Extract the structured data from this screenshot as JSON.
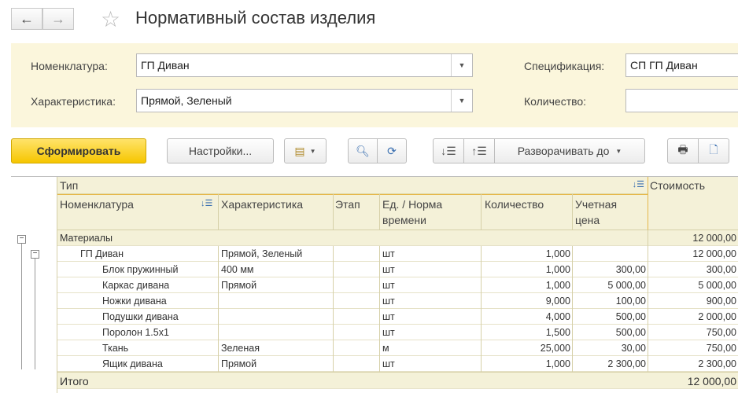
{
  "window": {
    "title": "Нормативный состав изделия"
  },
  "icons": {
    "back": "arrow-left-icon",
    "forward": "arrow-right-icon",
    "favorite": "star-icon"
  },
  "form": {
    "nomenclature_label": "Номенклатура:",
    "nomenclature_value": "ГП Диван",
    "characteristic_label": "Характеристика:",
    "characteristic_value": "Прямой, Зеленый",
    "specification_label": "Спецификация:",
    "specification_value": "СП ГП Диван",
    "quantity_label": "Количество:",
    "quantity_value": ""
  },
  "toolbar": {
    "generate_label": "Сформировать",
    "settings_label": "Настройки...",
    "expand_label": "Разворачивать до"
  },
  "table": {
    "headers": {
      "type": "Тип",
      "nomenclature": "Номенклатура",
      "characteristic": "Характеристика",
      "stage": "Этап",
      "unit_norm_1": "Ед. / Норма",
      "unit_norm_2": "времени",
      "quantity": "Количество",
      "price_1": "Учетная",
      "price_2": "цена",
      "cost": "Стоимость"
    },
    "group": {
      "type": "Материалы",
      "cost": "12 000,00"
    },
    "product": {
      "name": "ГП Диван",
      "characteristic": "Прямой, Зеленый",
      "unit": "шт",
      "quantity": "1,000",
      "price": "",
      "cost": "12 000,00"
    },
    "rows": [
      {
        "name": "Блок пружинный",
        "characteristic": "400 мм",
        "unit": "шт",
        "quantity": "1,000",
        "price": "300,00",
        "cost": "300,00"
      },
      {
        "name": "Каркас дивана",
        "characteristic": "Прямой",
        "unit": "шт",
        "quantity": "1,000",
        "price": "5 000,00",
        "cost": "5 000,00"
      },
      {
        "name": "Ножки дивана",
        "characteristic": "",
        "unit": "шт",
        "quantity": "9,000",
        "price": "100,00",
        "cost": "900,00"
      },
      {
        "name": "Подушки дивана",
        "characteristic": "",
        "unit": "шт",
        "quantity": "4,000",
        "price": "500,00",
        "cost": "2 000,00"
      },
      {
        "name": "Поролон 1.5х1",
        "characteristic": "",
        "unit": "шт",
        "quantity": "1,500",
        "price": "500,00",
        "cost": "750,00"
      },
      {
        "name": "Ткань",
        "characteristic": "Зеленая",
        "unit": "м",
        "quantity": "25,000",
        "price": "30,00",
        "cost": "750,00"
      },
      {
        "name": "Ящик дивана",
        "characteristic": "Прямой",
        "unit": "шт",
        "quantity": "1,000",
        "price": "2 300,00",
        "cost": "2 300,00"
      }
    ],
    "total": {
      "label": "Итого",
      "cost": "12 000,00"
    }
  }
}
